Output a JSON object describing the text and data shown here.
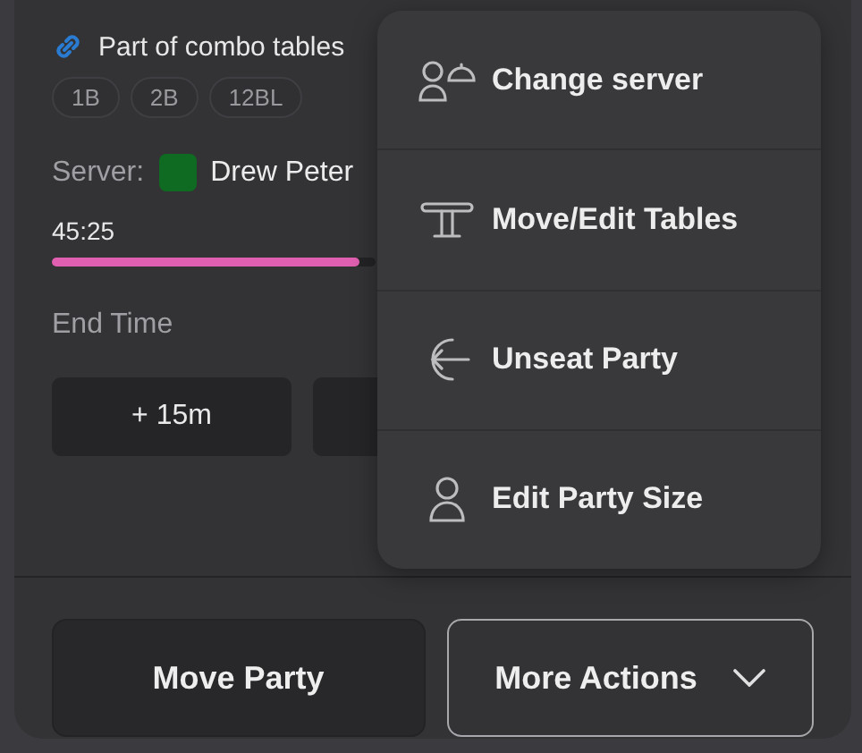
{
  "combo": {
    "label": "Part of combo tables",
    "tables": [
      "1B",
      "2B",
      "12BL"
    ]
  },
  "server": {
    "label": "Server:",
    "name": "Drew Peter",
    "color": "#0f6b22"
  },
  "timer": {
    "reading": "45:25",
    "level": 0.95
  },
  "end_time": {
    "label": "End Time"
  },
  "time_buttons": [
    "+ 15m"
  ],
  "actions": [
    {
      "label": "Move Party",
      "kind": "filled"
    },
    {
      "label": "More Actions",
      "kind": "dropdown"
    }
  ],
  "menu": [
    "Change server",
    "Move/Edit Tables",
    "Unseat Party",
    "Edit Party Size"
  ]
}
